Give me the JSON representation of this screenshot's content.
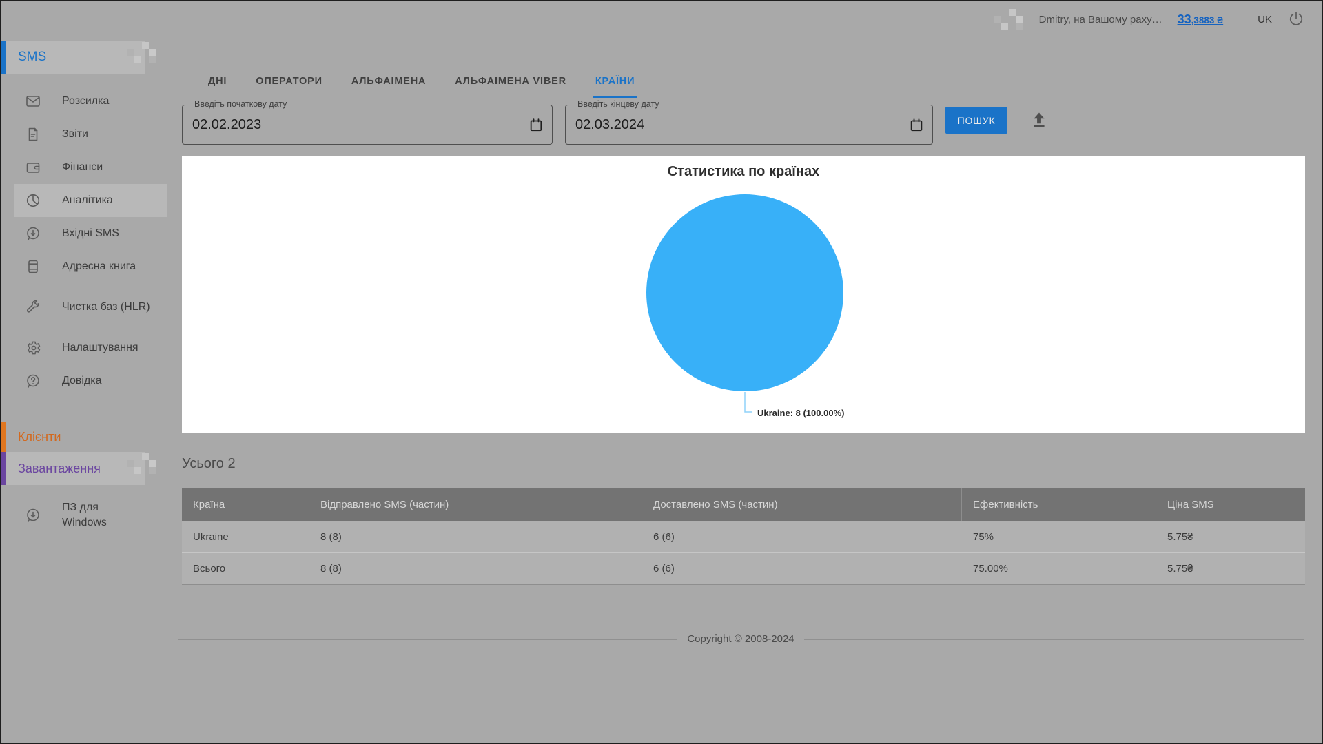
{
  "header": {
    "user_text": "Dmitry, на Вашому раху…",
    "balance_whole": "33",
    "balance_fraction": ",3883 ₴",
    "balance_full": "33,3883 ₴",
    "language": "UK"
  },
  "sidebar": {
    "sms_title": "SMS",
    "items": [
      {
        "label": "Розсилка",
        "icon": "envelope-icon"
      },
      {
        "label": "Звіти",
        "icon": "report-icon"
      },
      {
        "label": "Фінанси",
        "icon": "wallet-icon"
      },
      {
        "label": "Аналітика",
        "icon": "pie-chart-icon",
        "selected": true
      },
      {
        "label": "Вхідні SMS",
        "icon": "incoming-message-icon"
      },
      {
        "label": "Адресна книга",
        "icon": "address-book-icon"
      },
      {
        "label": "Чистка баз (HLR)",
        "icon": "wrench-icon"
      },
      {
        "label": "Налаштування",
        "icon": "gear-icon"
      },
      {
        "label": "Довідка",
        "icon": "help-icon"
      }
    ],
    "clients_title": "Клієнти",
    "downloads_title": "Завантаження",
    "pz_item": "ПЗ для Windows"
  },
  "tabs": [
    {
      "label": "ДНІ"
    },
    {
      "label": "ОПЕРАТОРИ"
    },
    {
      "label": "АЛЬФАІМЕНА"
    },
    {
      "label": "АЛЬФАІМЕНА VIBER"
    },
    {
      "label": "КРАЇНИ",
      "active": true
    }
  ],
  "filters": {
    "start_date": {
      "label": "Введіть початкову дату",
      "value": "02.02.2023"
    },
    "end_date": {
      "label": "Введіть кінцеву дату",
      "value": "02.03.2024"
    },
    "search_button": "ПОШУК"
  },
  "chart": {
    "title": "Статистика по країнах",
    "point_label": "Ukraine: 8 (100.00%)"
  },
  "chart_data": {
    "type": "pie",
    "title": "Статистика по країнах",
    "labels": [
      "Ukraine"
    ],
    "values": [
      8
    ],
    "percentages": [
      100.0
    ],
    "colors": [
      "#38b0f8"
    ],
    "legend_position": "none"
  },
  "summary": {
    "total_label": "Усього 2"
  },
  "table": {
    "headers": [
      "Країна",
      "Відправлено SMS (частин)",
      "Доставлено SMS (частин)",
      "Ефективність",
      "Ціна SMS"
    ],
    "rows": [
      [
        "Ukraine",
        "8 (8)",
        "6 (6)",
        "75%",
        "5.75₴"
      ],
      [
        "Всього",
        "8 (8)",
        "6 (6)",
        "75.00%",
        "5.75₴"
      ]
    ]
  },
  "footer": {
    "copyright": "Copyright © 2008-2024"
  },
  "colors": {
    "accent_blue": "#1a73c8",
    "pie_blue": "#38b0f8",
    "clients_orange": "#d2691f",
    "downloads_purple": "#6b46a0",
    "page_background": "#a9a9a9"
  }
}
